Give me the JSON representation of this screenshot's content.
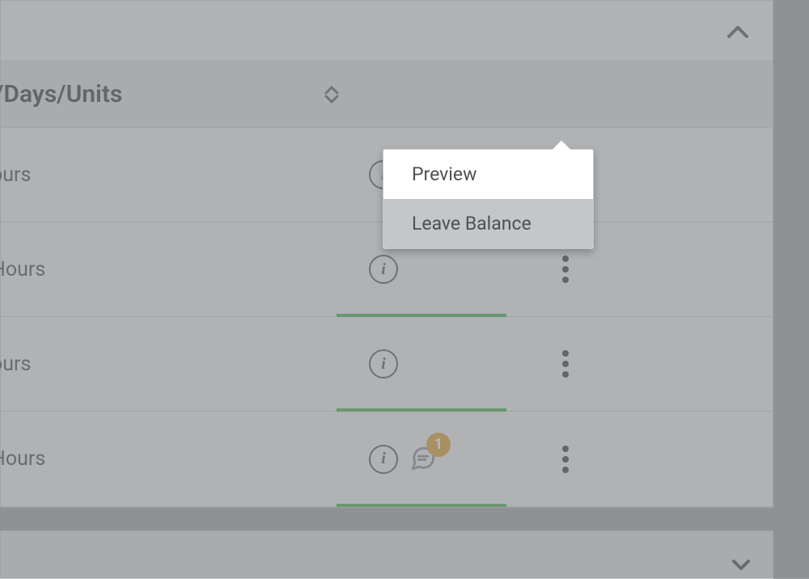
{
  "column_header": "/Days/Units",
  "rows": [
    {
      "label": "ours",
      "has_progress": false,
      "has_comment": false
    },
    {
      "label": "Hours",
      "has_progress": true,
      "has_comment": false
    },
    {
      "label": "ours",
      "has_progress": true,
      "has_comment": false
    },
    {
      "label": "Hours",
      "has_progress": true,
      "has_comment": true,
      "comment_count": "1"
    }
  ],
  "dropdown": {
    "items": [
      "Preview",
      "Leave Balance"
    ]
  }
}
